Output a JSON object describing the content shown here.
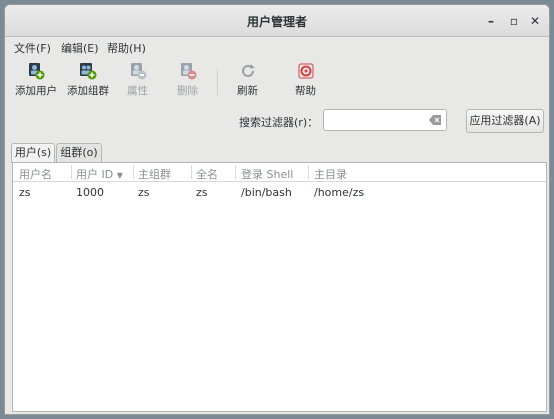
{
  "window": {
    "title": "用户管理者"
  },
  "menubar": {
    "file": "文件(F)",
    "edit": "编辑(E)",
    "help": "帮助(H)"
  },
  "toolbar": {
    "add_user": "添加用户",
    "add_group": "添加组群",
    "properties": "属性",
    "delete": "删除",
    "refresh": "刷新",
    "help": "帮助"
  },
  "filter": {
    "label": "搜索过滤器(r)：",
    "value": "",
    "apply": "应用过滤器(A)"
  },
  "tabs": {
    "users": "用户(s)",
    "groups": "组群(o)"
  },
  "table": {
    "columns": {
      "username": "用户名",
      "uid": "用户 ID",
      "group": "主组群",
      "fullname": "全名",
      "shell": "登录 Shell",
      "home": "主目录"
    },
    "rows": [
      {
        "username": "zs",
        "uid": "1000",
        "group": "zs",
        "fullname": "zs",
        "shell": "/bin/bash",
        "home": "/home/zs"
      }
    ]
  },
  "colors": {
    "background": "#7c8a96",
    "window": "#e8e8e7",
    "add_badge": "#4e9a06",
    "delete_badge": "#cc3333"
  }
}
